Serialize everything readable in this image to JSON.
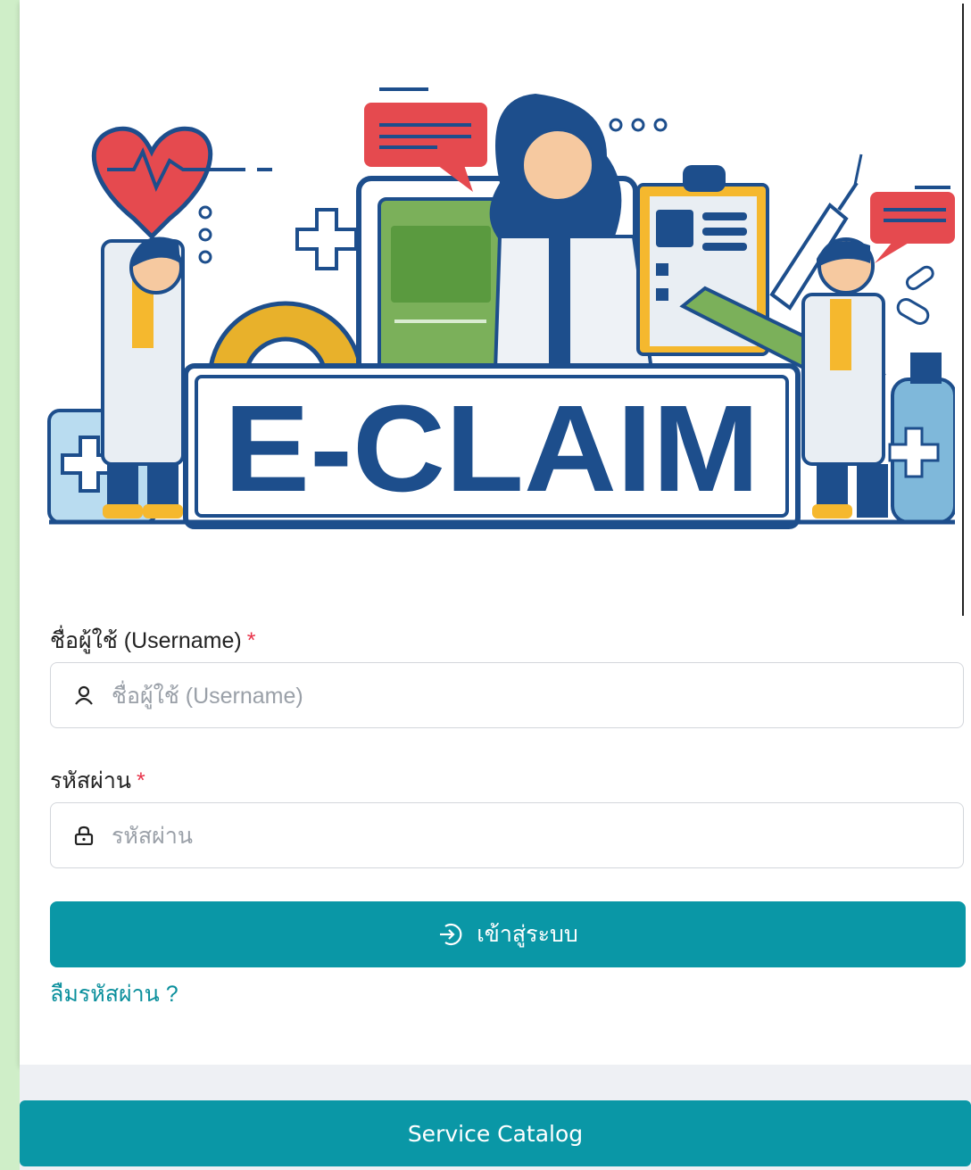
{
  "banner": {
    "title": "E-CLAIM"
  },
  "form": {
    "username": {
      "label": "ชื่อผู้ใช้ (Username)",
      "required_mark": "*",
      "placeholder": "ชื่อผู้ใช้ (Username)",
      "value": "",
      "icon": "user-icon"
    },
    "password": {
      "label": "รหัสผ่าน",
      "required_mark": "*",
      "placeholder": "รหัสผ่าน",
      "value": "",
      "icon": "lock-icon"
    },
    "login_button": {
      "label": "เข้าสู่ระบบ",
      "icon": "login-icon"
    },
    "forgot_link": "ลืมรหัสผ่าน ?"
  },
  "footer": {
    "service_catalog_label": "Service Catalog"
  },
  "colors": {
    "primary": "#0a97a6",
    "link": "#0a8f9c",
    "required": "#e8334a",
    "banner_navy": "#1d4e8c"
  }
}
